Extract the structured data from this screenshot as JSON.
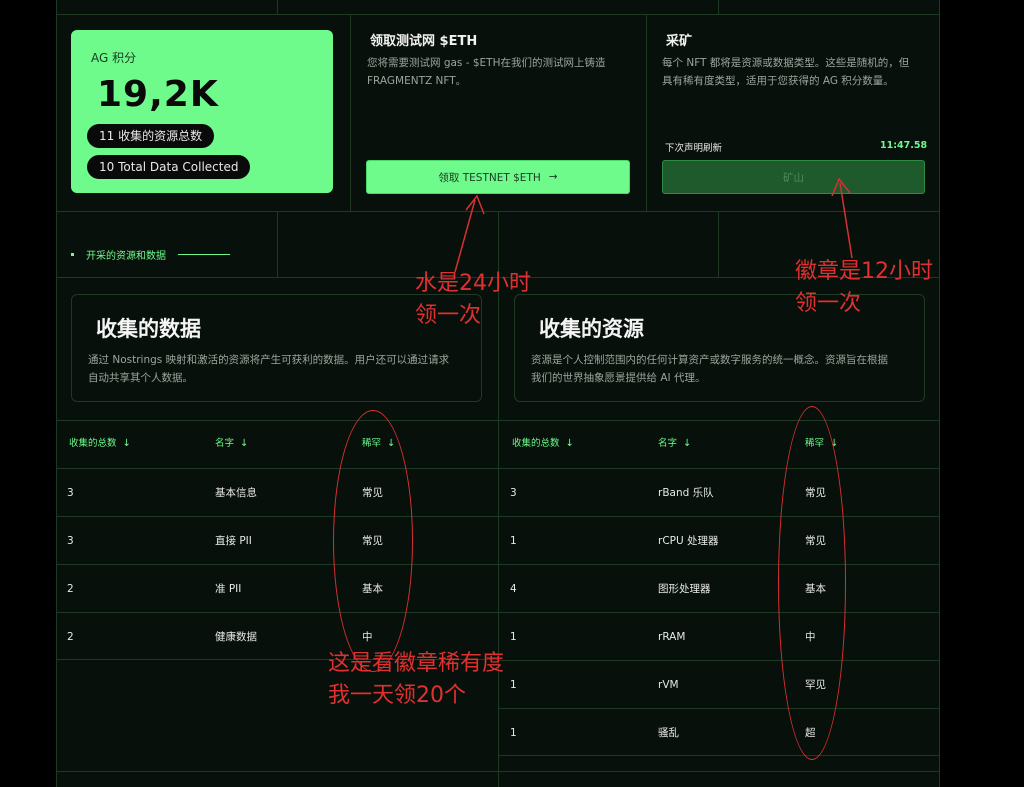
{
  "points": {
    "label": "AG 积分",
    "value": "19,2K",
    "pill_resources": "11 收集的资源总数",
    "pill_data": "10 Total Data Collected"
  },
  "faucet": {
    "title": "领取测试网 $ETH",
    "desc_line1": "您将需要测试网 gas - $ETH在我们的测试网上铸造",
    "desc_line2": "FRAGMENTZ NFT。",
    "button_label": "领取 TESTNET $ETH",
    "button_arrow": "→"
  },
  "mining": {
    "title": "采矿",
    "desc_line1": "每个 NFT 都将是资源或数据类型。这些是随机的，但",
    "desc_line2": "具有稀有度类型，适用于您获得的 AG 积分数量。",
    "refresh_label": "下次声明刷新",
    "refresh_time": "11:47.58",
    "button_label": "矿山"
  },
  "section_link": "开采的资源和数据",
  "data_box": {
    "title": "收集的数据",
    "desc_line1": "通过 Nostrings 映射和激活的资源将产生可获利的数据。用户还可以通过请求",
    "desc_line2": "自动共享其个人数据。"
  },
  "resource_box": {
    "title": "收集的资源",
    "desc_line1": "资源是个人控制范围内的任何计算资产或数字服务的统一概念。资源旨在根据",
    "desc_line2": "我们的世界抽象愿景提供给 AI 代理。"
  },
  "data_table": {
    "headers": [
      "收集的总数",
      "名字",
      "稀罕"
    ],
    "rows": [
      [
        "3",
        "基本信息",
        "常见"
      ],
      [
        "3",
        "直接 PII",
        "常见"
      ],
      [
        "2",
        "准 PII",
        "基本"
      ],
      [
        "2",
        "健康数据",
        "中"
      ]
    ]
  },
  "resource_table": {
    "headers": [
      "收集的总数",
      "名字",
      "稀罕"
    ],
    "rows": [
      [
        "3",
        "rBand 乐队",
        "常见"
      ],
      [
        "1",
        "rCPU 处理器",
        "常见"
      ],
      [
        "4",
        "图形处理器",
        "基本"
      ],
      [
        "1",
        "rRAM",
        "中"
      ],
      [
        "1",
        "rVM",
        "罕见"
      ],
      [
        "1",
        "骚乱",
        "超"
      ]
    ]
  },
  "annotations": {
    "water_line1": "水是24小时",
    "water_line2": "领一次",
    "badge_line1": "徽章是12小时",
    "badge_line2": "领一次",
    "rarity_line1": "这是看徽章稀有度",
    "rarity_line2": "我一天领20个"
  },
  "colors": {
    "accent": "#6efb8c",
    "background": "#07100a",
    "annotation": "#e03030"
  }
}
